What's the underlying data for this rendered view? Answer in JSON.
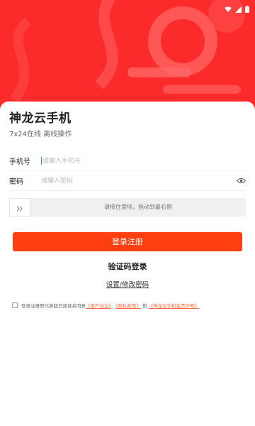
{
  "hero": {
    "colors": {
      "bg": "#fb2b2b",
      "accent": "#ff5e5e"
    }
  },
  "statusbar": {
    "icons": [
      "wifi-icon",
      "signal-icon",
      "battery-icon"
    ]
  },
  "app": {
    "title": "神龙云手机",
    "subtitle": "7x24在线 离线操作"
  },
  "form": {
    "phone": {
      "label": "手机号",
      "placeholder": "请输入手机号",
      "value": ""
    },
    "password": {
      "label": "密码",
      "placeholder": "请输入密码",
      "value": "",
      "toggle_icon": "eye-icon"
    }
  },
  "slider": {
    "text": "请按住滑块，拖动到最右侧",
    "handle_icon": "double-chevron-right-icon"
  },
  "buttons": {
    "login": "登录注册",
    "code_login": "验证码登录",
    "set_password": "设置/修改密码"
  },
  "agreement": {
    "prefix": "登录注册即代表我已阅读并同意",
    "user_agreement": "《用户协议》",
    "sep1": "、",
    "privacy_policy": "《隐私政策》",
    "and": "和",
    "disclaimer": "《神龙云手机免责声明》"
  },
  "colors": {
    "primary": "#ff3f10",
    "link": "#ff6a3d"
  }
}
